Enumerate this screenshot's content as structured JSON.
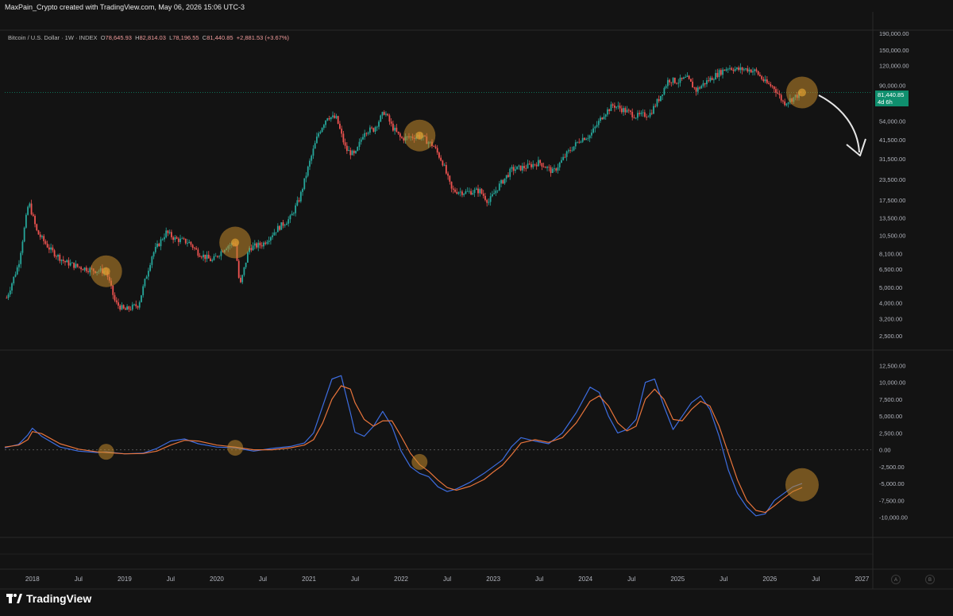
{
  "header": {
    "title": "MaxPain_Crypto created with TradingView.com, May 06, 2026 15:06 UTC-3"
  },
  "legend": {
    "symbol": "Bitcoin / U.S. Dollar · 1W · INDEX",
    "open_label": "O",
    "open": "78,645.93",
    "high_label": "H",
    "high": "82,814.03",
    "low_label": "L",
    "low": "78,196.55",
    "close_label": "C",
    "close": "81,440.85",
    "change": "+2,881.53 (+3.67%)"
  },
  "price_badge": {
    "price": "81,440.85",
    "countdown": "4d 6h"
  },
  "branding": {
    "name": "TradingView"
  },
  "axis_buttons": {
    "auto": "A",
    "log": "B"
  },
  "colors": {
    "background": "#131313",
    "up_candle": "#26a69a",
    "down_candle": "#ef5350",
    "fast_line": "#3d6de0",
    "slow_line": "#e8743b",
    "highlight": "#c48a2c",
    "badge": "#0f8f6e"
  },
  "chart_data": [
    {
      "type": "candlestick",
      "title": "Bitcoin / U.S. Dollar · 1W · INDEX",
      "yscale": "log",
      "ylim": [
        2500,
        190000
      ],
      "y_ticks": [
        "190,000.00",
        "150,000.00",
        "120,000.00",
        "90,000.00",
        "70,000.00",
        "54,000.00",
        "41,500.00",
        "31,500.00",
        "23,500.00",
        "17,500.00",
        "13,500.00",
        "10,500.00",
        "8,100.00",
        "6,500.00",
        "5,000.00",
        "4,000.00",
        "3,200.00",
        "2,500.00"
      ],
      "y_tick_values": [
        190000,
        150000,
        120000,
        90000,
        70000,
        54000,
        41500,
        31500,
        23500,
        17500,
        13500,
        10500,
        8100,
        6500,
        5000,
        4000,
        3200,
        2500
      ],
      "x_ticks": [
        "2018",
        "Jul",
        "2019",
        "Jul",
        "2020",
        "Jul",
        "2021",
        "Jul",
        "2022",
        "Jul",
        "2023",
        "Jul",
        "2024",
        "Jul",
        "2025",
        "Jul",
        "2026",
        "Jul",
        "2027"
      ],
      "x_tick_values": [
        2018.0,
        2018.5,
        2019.0,
        2019.5,
        2020.0,
        2020.5,
        2021.0,
        2021.5,
        2022.0,
        2022.5,
        2023.0,
        2023.5,
        2024.0,
        2024.5,
        2025.0,
        2025.5,
        2026.0,
        2026.5,
        2027.0
      ],
      "xlim": [
        2017.7,
        2027.1
      ],
      "price_path": {
        "x": [
          2017.72,
          2017.85,
          2017.96,
          2018.05,
          2018.2,
          2018.35,
          2018.5,
          2018.65,
          2018.8,
          2018.9,
          2019.0,
          2019.15,
          2019.3,
          2019.45,
          2019.55,
          2019.7,
          2019.8,
          2019.95,
          2020.1,
          2020.2,
          2020.25,
          2020.35,
          2020.5,
          2020.65,
          2020.8,
          2020.9,
          2021.0,
          2021.1,
          2021.2,
          2021.3,
          2021.4,
          2021.5,
          2021.6,
          2021.7,
          2021.82,
          2021.9,
          2022.0,
          2022.1,
          2022.2,
          2022.35,
          2022.45,
          2022.55,
          2022.7,
          2022.85,
          2022.95,
          2023.05,
          2023.2,
          2023.35,
          2023.5,
          2023.65,
          2023.8,
          2023.95,
          2024.05,
          2024.2,
          2024.3,
          2024.45,
          2024.55,
          2024.7,
          2024.8,
          2024.9,
          2025.0,
          2025.1,
          2025.2,
          2025.3,
          2025.45,
          2025.55,
          2025.65,
          2025.75,
          2025.85,
          2025.95,
          2026.05,
          2026.15,
          2026.25,
          2026.35
        ],
        "y": [
          4300,
          7000,
          17000,
          11000,
          8500,
          7200,
          6700,
          6400,
          6300,
          4000,
          3600,
          3900,
          8000,
          11000,
          10000,
          9500,
          8200,
          7300,
          9000,
          9500,
          5000,
          8800,
          9300,
          11500,
          13500,
          18000,
          29000,
          45000,
          58000,
          56000,
          36000,
          33000,
          47000,
          48000,
          62000,
          50000,
          42000,
          43000,
          44000,
          38000,
          30000,
          20000,
          19500,
          20000,
          17000,
          21000,
          27000,
          28000,
          30000,
          26000,
          34000,
          42000,
          44000,
          60000,
          68000,
          62000,
          58000,
          60000,
          75000,
          98000,
          95000,
          100000,
          84000,
          94000,
          108000,
          117000,
          113000,
          114000,
          110000,
          94000,
          87000,
          70000,
          75000,
          81440
        ]
      },
      "annotations": [
        {
          "label": "highlight",
          "x": 2018.8,
          "y": 6300
        },
        {
          "label": "highlight",
          "x": 2020.2,
          "y": 9500
        },
        {
          "label": "highlight",
          "x": 2022.2,
          "y": 44000
        },
        {
          "label": "highlight",
          "x": 2026.35,
          "y": 81440
        }
      ]
    },
    {
      "type": "line",
      "ylim": [
        -11000,
        13500
      ],
      "y_ticks": [
        "12,500.00",
        "10,000.00",
        "7,500.00",
        "5,000.00",
        "2,500.00",
        "0.00",
        "-2,500.00",
        "-5,000.00",
        "-7,500.00",
        "-10,000.00"
      ],
      "y_tick_values": [
        12500,
        10000,
        7500,
        5000,
        2500,
        0,
        -2500,
        -5000,
        -7500,
        -10000
      ],
      "x": [
        2017.7,
        2017.85,
        2017.95,
        2018.0,
        2018.1,
        2018.3,
        2018.5,
        2018.7,
        2018.8,
        2019.0,
        2019.2,
        2019.35,
        2019.5,
        2019.65,
        2019.8,
        2020.0,
        2020.2,
        2020.4,
        2020.6,
        2020.8,
        2020.95,
        2021.05,
        2021.15,
        2021.25,
        2021.35,
        2021.45,
        2021.5,
        2021.6,
        2021.7,
        2021.8,
        2021.9,
        2022.0,
        2022.1,
        2022.2,
        2022.3,
        2022.4,
        2022.5,
        2022.6,
        2022.75,
        2022.9,
        2023.0,
        2023.1,
        2023.2,
        2023.3,
        2023.45,
        2023.6,
        2023.75,
        2023.9,
        2024.05,
        2024.15,
        2024.25,
        2024.35,
        2024.45,
        2024.55,
        2024.65,
        2024.75,
        2024.85,
        2024.95,
        2025.05,
        2025.15,
        2025.25,
        2025.35,
        2025.45,
        2025.55,
        2025.65,
        2025.75,
        2025.85,
        2025.95,
        2026.05,
        2026.15,
        2026.25,
        2026.35
      ],
      "series": [
        {
          "values": [
            300,
            800,
            2200,
            3200,
            2000,
            400,
            -200,
            -400,
            -300,
            -600,
            -500,
            200,
            1300,
            1600,
            900,
            400,
            300,
            -200,
            200,
            500,
            1000,
            2500,
            6500,
            10500,
            11000,
            5500,
            2600,
            2000,
            3500,
            5700,
            3500,
            -200,
            -2500,
            -3500,
            -4000,
            -5500,
            -6200,
            -5800,
            -4800,
            -3500,
            -2500,
            -1500,
            500,
            1800,
            1300,
            900,
            2500,
            5500,
            9300,
            8500,
            5000,
            2500,
            3000,
            4500,
            10000,
            10500,
            6500,
            3000,
            5000,
            7000,
            8000,
            6000,
            2000,
            -3000,
            -6500,
            -8500,
            -9800,
            -9500,
            -7500,
            -6500,
            -5500,
            -5000
          ]
        },
        {
          "values": [
            400,
            700,
            1500,
            2700,
            2400,
            900,
            100,
            -300,
            -400,
            -600,
            -550,
            -200,
            700,
            1400,
            1300,
            700,
            400,
            0,
            0,
            300,
            700,
            1500,
            4000,
            7500,
            9500,
            9000,
            7000,
            4500,
            3500,
            4300,
            4300,
            2000,
            -500,
            -2200,
            -3200,
            -4500,
            -5600,
            -6000,
            -5400,
            -4400,
            -3300,
            -2300,
            -700,
            1000,
            1500,
            1100,
            1800,
            4000,
            7200,
            8000,
            6500,
            4000,
            2800,
            3500,
            7500,
            9000,
            7500,
            4500,
            4300,
            6000,
            7200,
            6500,
            3500,
            -500,
            -4500,
            -7500,
            -9000,
            -9300,
            -8300,
            -7200,
            -6200,
            -5600
          ]
        }
      ],
      "annotations": [
        {
          "label": "highlight",
          "x": 2018.8,
          "y": -300
        },
        {
          "label": "highlight",
          "x": 2020.2,
          "y": 300
        },
        {
          "label": "highlight",
          "x": 2022.2,
          "y": -1800
        },
        {
          "label": "highlight",
          "x": 2026.35,
          "y": -5200
        }
      ]
    }
  ]
}
